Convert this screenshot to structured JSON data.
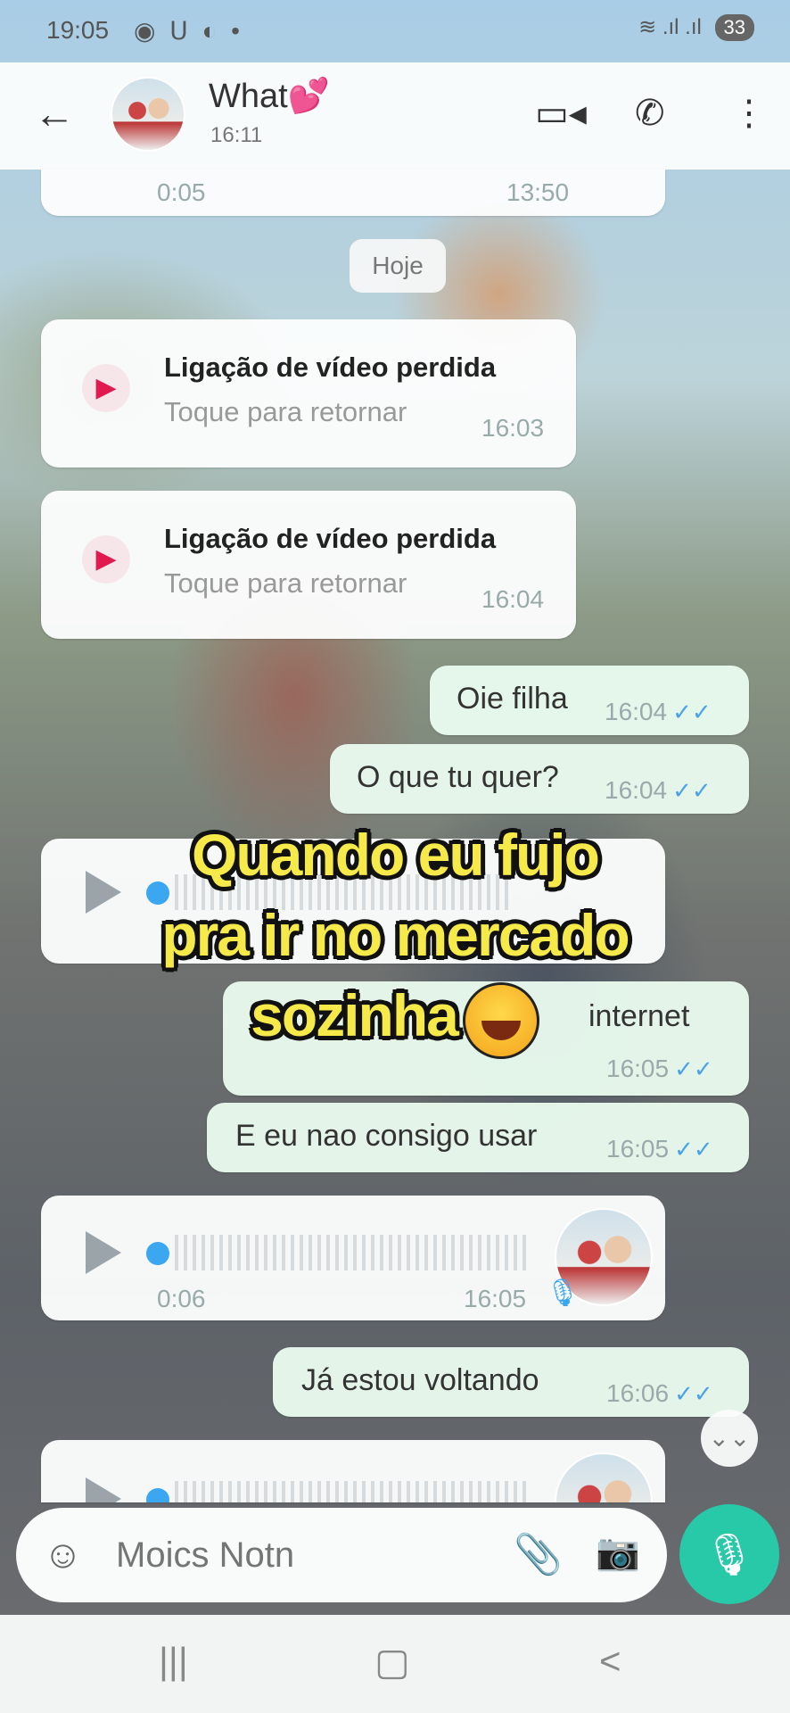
{
  "status_bar": {
    "time": "19:05",
    "notification_icons": "◉ ᑌ ◐ •",
    "signal": "≋ .ıl .ıl",
    "battery": "33"
  },
  "header": {
    "back_icon": "←",
    "contact_name": "What",
    "heart": "💕",
    "last_seen": "16:11",
    "video_icon": "▭◂",
    "call_icon": "✆",
    "menu_icon": "⋮"
  },
  "messages": {
    "top_audio": {
      "duration": "0:05",
      "time": "13:50"
    },
    "date_chip": "Hoje",
    "call1": {
      "title": "Ligação de vídeo perdida",
      "subtitle": "Toque para retornar",
      "time": "16:03"
    },
    "call2": {
      "title": "Ligação de vídeo perdida",
      "subtitle": "Toque para retornar",
      "time": "16:04"
    },
    "msg1": {
      "text": "Oie filha",
      "time": "16:04"
    },
    "msg2": {
      "text": "O que tu quer?",
      "time": "16:04"
    },
    "msg3": {
      "text": "internet",
      "time": "16:05"
    },
    "msg4": {
      "text": "E eu nao consigo usar",
      "time": "16:05"
    },
    "audio2": {
      "duration": "0:06",
      "time": "16:05"
    },
    "msg5": {
      "text": "Já estou voltando",
      "time": "16:06"
    },
    "tick_glyph": "✓✓"
  },
  "caption": {
    "line1": "Quando eu fujo",
    "line2": "pra ir no mercado",
    "line3": "sozinha"
  },
  "composer": {
    "placeholder": "Moics Notn",
    "emoji_icon": "☺",
    "clip_icon": "📎",
    "camera_icon": "📷",
    "mic_icon": "🎙"
  },
  "scroll_down_icon": "⌄⌄",
  "navbar": {
    "recents": "|||",
    "home": "▢",
    "back": "<"
  }
}
